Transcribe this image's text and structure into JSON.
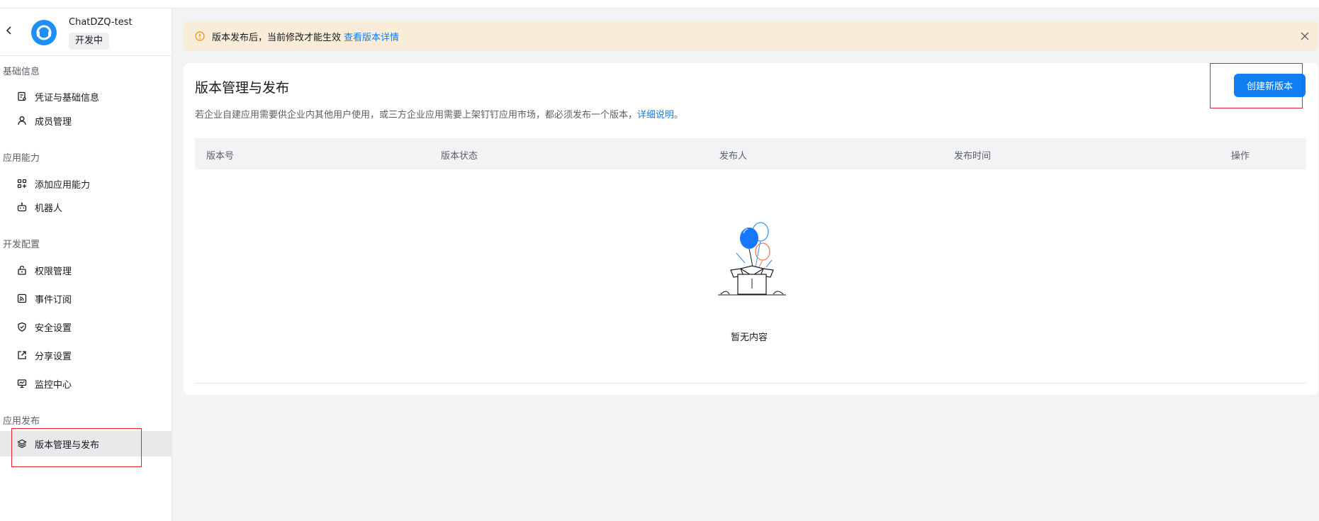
{
  "app": {
    "name": "ChatDZQ-test",
    "status": "开发中"
  },
  "sidebar": {
    "groups": [
      {
        "title": "基础信息",
        "items": [
          {
            "label": "凭证与基础信息",
            "icon": "credential-icon"
          },
          {
            "label": "成员管理",
            "icon": "user-icon"
          }
        ]
      },
      {
        "title": "应用能力",
        "items": [
          {
            "label": "添加应用能力",
            "icon": "add-capability-icon"
          },
          {
            "label": "机器人",
            "icon": "robot-icon"
          }
        ]
      },
      {
        "title": "开发配置",
        "items": [
          {
            "label": "权限管理",
            "icon": "lock-icon"
          },
          {
            "label": "事件订阅",
            "icon": "rss-icon"
          },
          {
            "label": "安全设置",
            "icon": "shield-icon"
          },
          {
            "label": "分享设置",
            "icon": "share-icon"
          },
          {
            "label": "监控中心",
            "icon": "monitor-icon"
          }
        ]
      },
      {
        "title": "应用发布",
        "items": [
          {
            "label": "版本管理与发布",
            "icon": "layers-icon",
            "active": true
          }
        ]
      }
    ]
  },
  "notice": {
    "text": "版本发布后，当前修改才能生效",
    "link": "查看版本详情"
  },
  "main": {
    "title": "版本管理与发布",
    "description": "若企业自建应用需要供企业内其他用户使用，或三方企业应用需要上架钉钉应用市场，都必须发布一个版本，",
    "description_link": "详细说明",
    "description_end": "。",
    "create_button": "创建新版本",
    "columns": [
      "版本号",
      "版本状态",
      "发布人",
      "发布时间",
      "操作"
    ],
    "empty_text": "暂无内容"
  },
  "colors": {
    "primary": "#0f7ef0",
    "notice_bg": "#f9ecd9",
    "highlight": "#e8212a"
  }
}
